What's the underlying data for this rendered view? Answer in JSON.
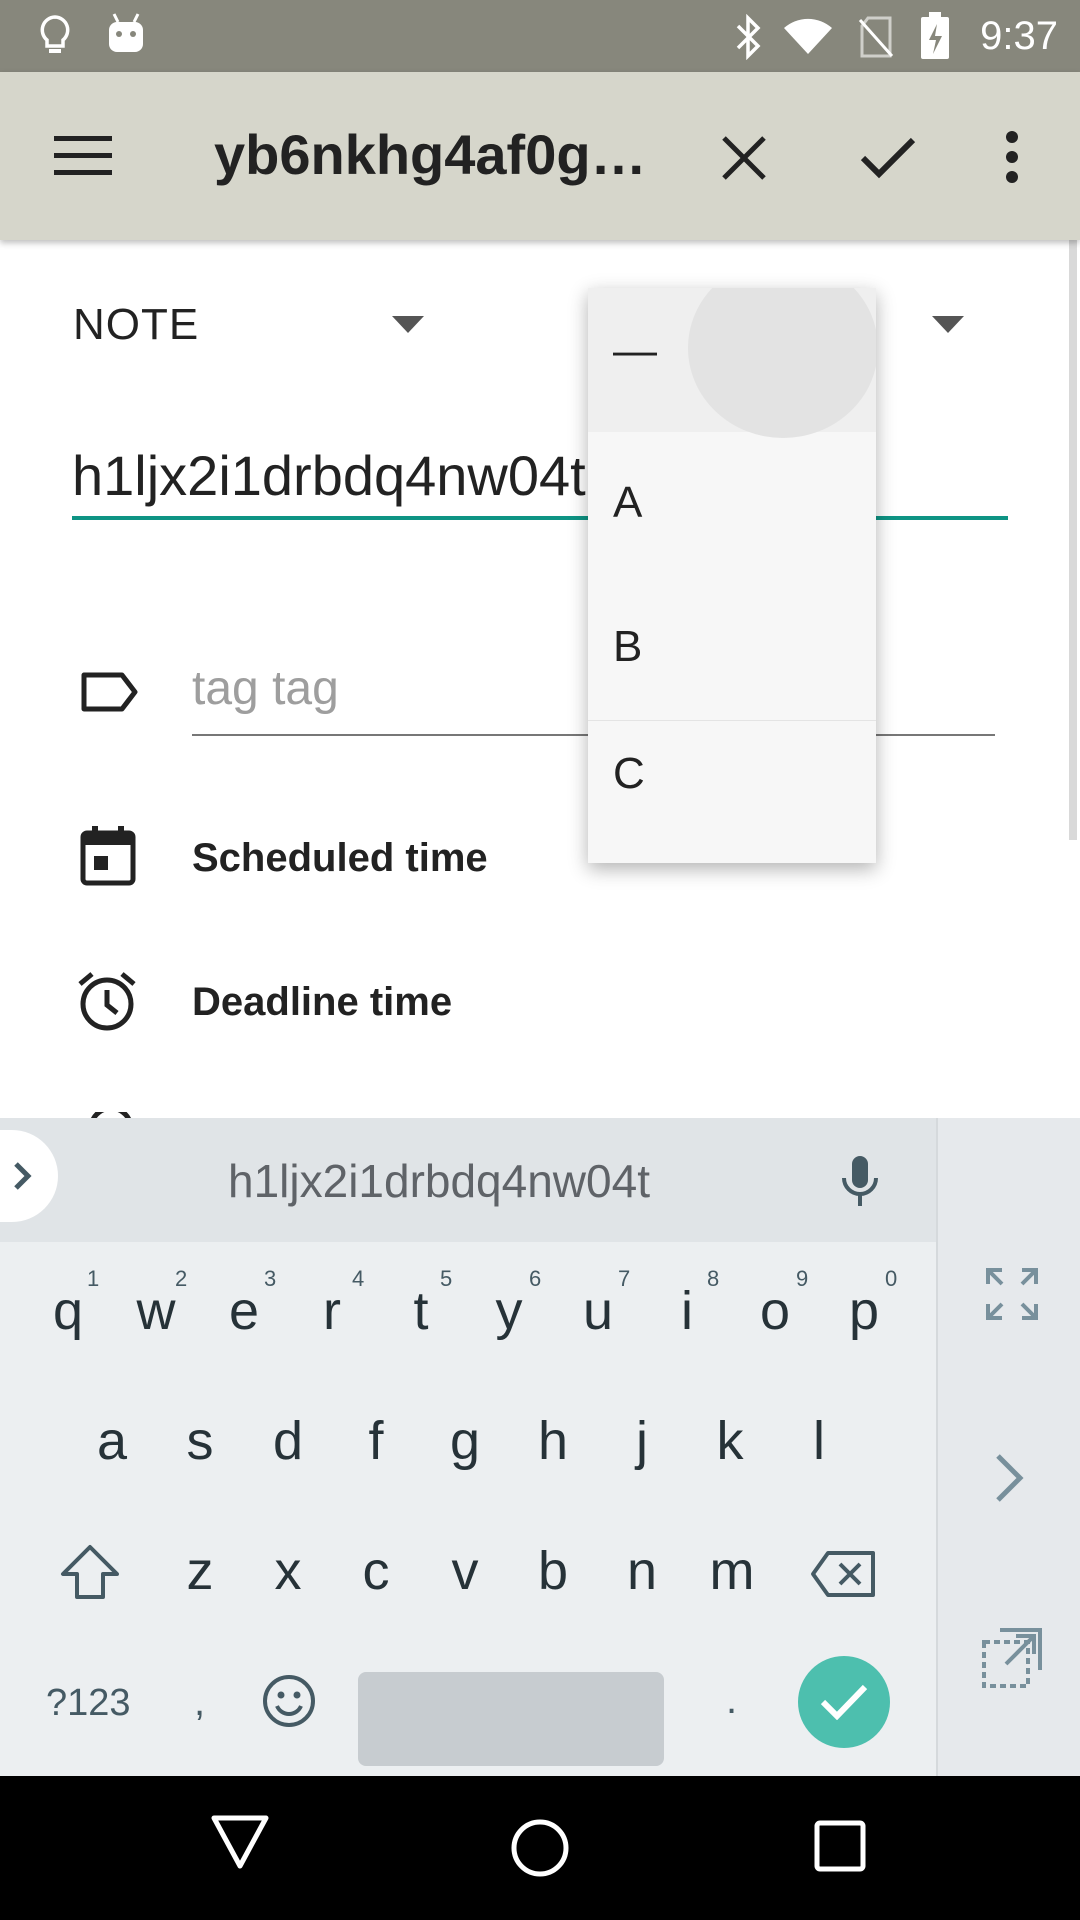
{
  "status_bar": {
    "time": "9:37",
    "icons": [
      "lightbulb-icon",
      "android-icon",
      "bluetooth-icon",
      "wifi-icon",
      "no-sim-icon",
      "battery-charging-icon"
    ]
  },
  "app_bar": {
    "title": "yb6nkhg4af0g…",
    "icons": [
      "menu-icon",
      "close-icon",
      "check-icon",
      "more-vert-icon"
    ]
  },
  "form": {
    "state_value": "NOTE",
    "title_value": "h1ljx2i1drbdq4nw04t",
    "tags_placeholder": "tag tag",
    "scheduled_label": "Scheduled time",
    "deadline_label": "Deadline time"
  },
  "priority_dropdown": {
    "options": [
      "—",
      "A",
      "B",
      "C"
    ],
    "selected_index": 0
  },
  "keyboard": {
    "suggestion": "h1ljx2i1drbdq4nw04t",
    "row1": [
      "q",
      "w",
      "e",
      "r",
      "t",
      "y",
      "u",
      "i",
      "o",
      "p"
    ],
    "row1_hints": [
      "1",
      "2",
      "3",
      "4",
      "5",
      "6",
      "7",
      "8",
      "9",
      "0"
    ],
    "row2": [
      "a",
      "s",
      "d",
      "f",
      "g",
      "h",
      "j",
      "k",
      "l"
    ],
    "row3": [
      "z",
      "x",
      "c",
      "v",
      "b",
      "n",
      "m"
    ],
    "symbols_label": "?123",
    "comma": ",",
    "period": "."
  },
  "colors": {
    "status_bar": "#87877c",
    "app_bar": "#d6d6cb",
    "accent": "#0e9484",
    "enter_key": "#4dbfae"
  }
}
